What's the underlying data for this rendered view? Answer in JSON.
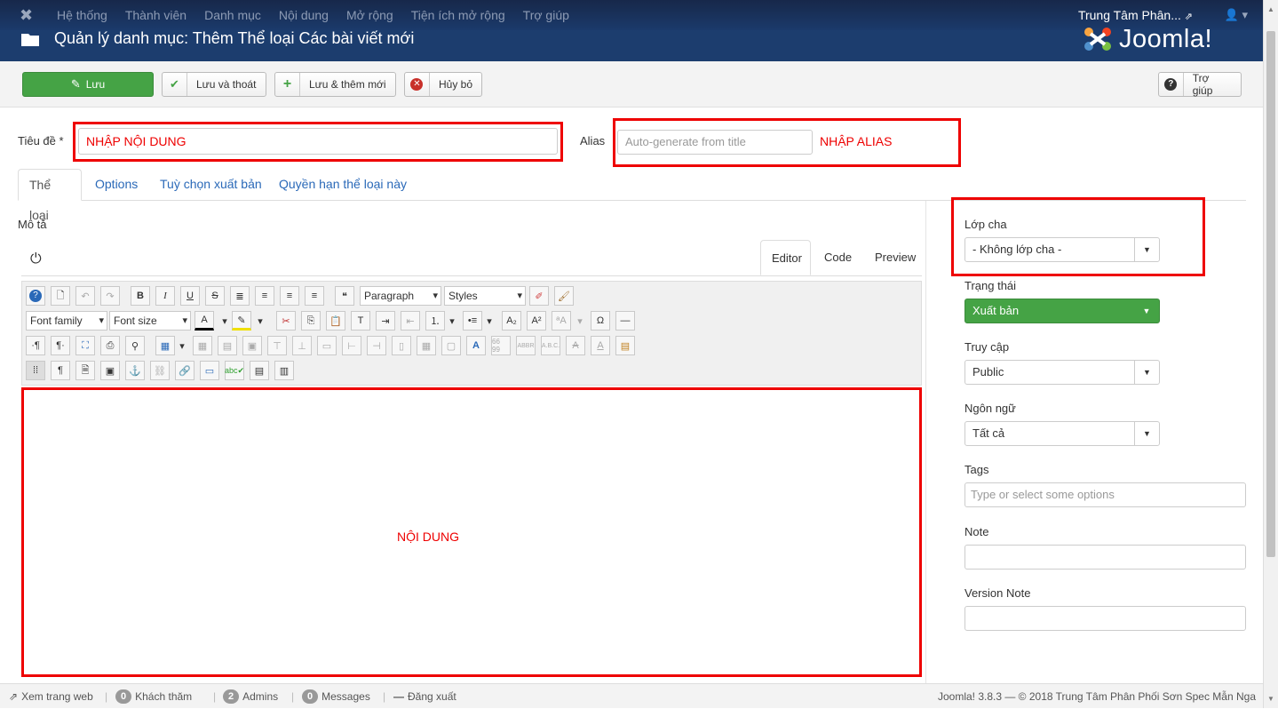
{
  "topnav": {
    "menu": [
      "Hệ thống",
      "Thành viên",
      "Danh mục",
      "Nội dung",
      "Mở rộng",
      "Tiện ích mở rộng",
      "Trợ giúp"
    ],
    "site_name": "Trung Tâm Phân...",
    "user_icon": "user-icon"
  },
  "header": {
    "title": "Quản lý danh mục: Thêm Thể loại Các bài viết mới",
    "brand": "Joomla!"
  },
  "toolbar": {
    "save": "Lưu",
    "save_close": "Lưu và thoát",
    "save_new": "Lưu & thêm mới",
    "cancel": "Hủy bỏ",
    "help": "Trợ giúp"
  },
  "form": {
    "title_label": "Tiêu đề *",
    "title_value": "NHẬP NỘI DUNG",
    "alias_label": "Alias",
    "alias_placeholder": "Auto-generate from title",
    "alias_annotation": "NHẬP ALIAS"
  },
  "tabs": [
    "Thể loại",
    "Options",
    "Tuỳ chọn xuất bản",
    "Quyền hạn thể loại này"
  ],
  "editor": {
    "description_label": "Mô tả",
    "tabs": [
      "Editor",
      "Code",
      "Preview"
    ],
    "paragraph": "Paragraph",
    "styles": "Styles",
    "font_family": "Font family",
    "font_size": "Font size",
    "content_annotation": "NỘI DUNG"
  },
  "sidebar": {
    "parent_label": "Lớp cha",
    "parent_value": "- Không lớp cha -",
    "status_label": "Trạng thái",
    "status_value": "Xuất bản",
    "access_label": "Truy cập",
    "access_value": "Public",
    "language_label": "Ngôn ngữ",
    "language_value": "Tất cả",
    "tags_label": "Tags",
    "tags_placeholder": "Type or select some options",
    "note_label": "Note",
    "version_note_label": "Version Note"
  },
  "footer": {
    "view_site": "Xem trang web",
    "visitors_count": "0",
    "visitors": "Khách thăm",
    "admins_count": "2",
    "admins": "Admins",
    "messages_count": "0",
    "messages": "Messages",
    "logout": "Đăng xuất",
    "copyright": "Joomla! 3.8.3  —  © 2018 Trung Tâm Phân Phối Sơn Spec Mẫn Nga"
  },
  "colors": {
    "navbar": "#1b3a6b",
    "save_green": "#45a345",
    "annotation_red": "#ee0000",
    "link_blue": "#2a69b8"
  }
}
